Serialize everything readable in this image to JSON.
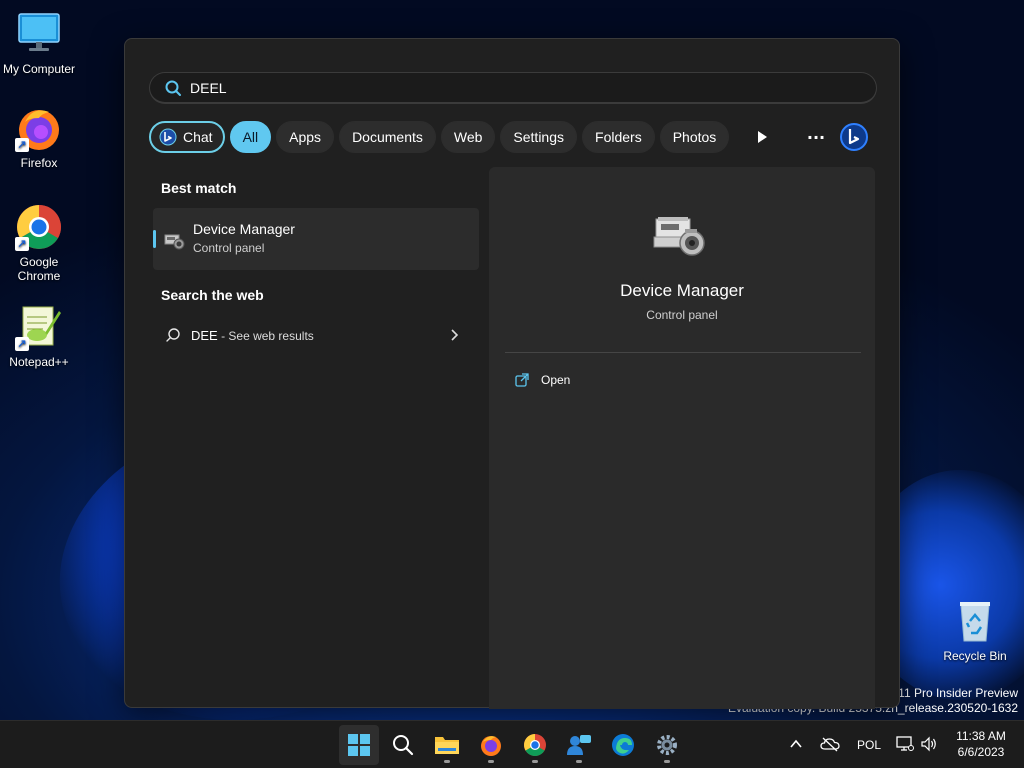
{
  "desktop": {
    "icons": [
      {
        "label": "My Computer"
      },
      {
        "label": "Firefox"
      },
      {
        "label": "Google Chrome"
      },
      {
        "label": "Notepad++"
      },
      {
        "label": "Recycle Bin"
      }
    ],
    "watermark_line1": "s 11 Pro Insider Preview",
    "watermark_line2": "Evaluation copy. Build 25375.zn_release.230520-1632"
  },
  "search": {
    "query": "DEEL",
    "filters": [
      "Chat",
      "All",
      "Apps",
      "Documents",
      "Web",
      "Settings",
      "Folders",
      "Photos"
    ],
    "active_filter": "All",
    "more_label": "···"
  },
  "results": {
    "best_match_heading": "Best match",
    "best_match": {
      "title": "Device Manager",
      "subtitle": "Control panel"
    },
    "web_heading": "Search the web",
    "web_result": {
      "query": "DEE",
      "suffix": " - See web results"
    }
  },
  "preview": {
    "title": "Device Manager",
    "subtitle": "Control panel",
    "action_open": "Open"
  },
  "taskbar": {
    "language": "POL",
    "time": "11:38 AM",
    "date": "6/6/2023"
  },
  "colors": {
    "accent": "#60c8f0",
    "panel_bg": "#202020",
    "pane_bg": "#2a2a2a",
    "taskbar_bg": "#1c1c1c"
  }
}
